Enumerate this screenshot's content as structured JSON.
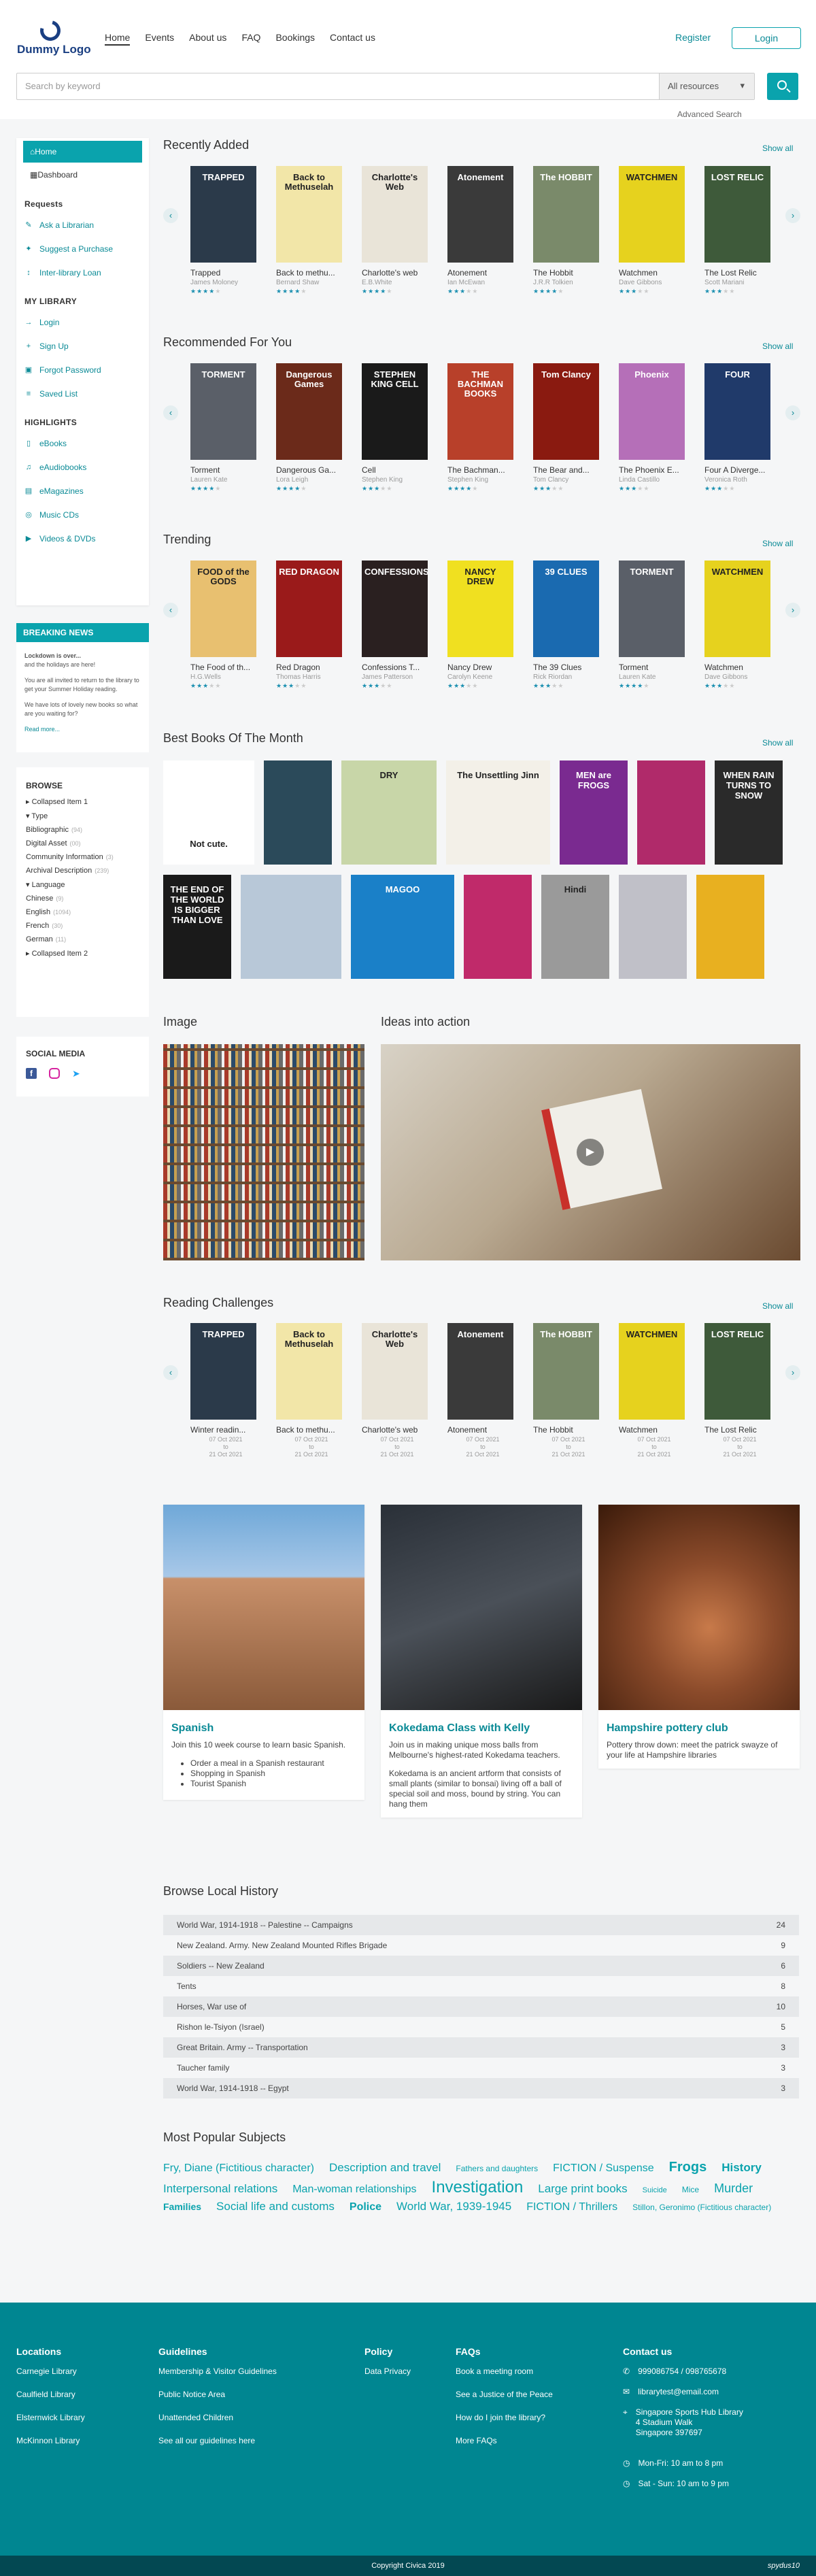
{
  "header": {
    "logo_text": "Dummy Logo",
    "nav": [
      "Home",
      "Events",
      "About us",
      "FAQ",
      "Bookings",
      "Contact us"
    ],
    "register": "Register",
    "login": "Login"
  },
  "search": {
    "placeholder": "Search by keyword",
    "scope": "All resources",
    "advanced": "Advanced Search"
  },
  "sidebar": {
    "home": "Home",
    "dashboard": "Dashboard",
    "requests_title": "Requests",
    "requests": [
      "Ask a Librarian",
      "Suggest a Purchase",
      "Inter-library Loan"
    ],
    "mylib_title": "MY LIBRARY",
    "mylib": [
      "Login",
      "Sign Up",
      "Forgot Password",
      "Saved List"
    ],
    "highlights_title": "HIGHLIGHTS",
    "highlights": [
      "eBooks",
      "eAudiobooks",
      "eMagazines",
      "Music CDs",
      "Videos & DVDs"
    ]
  },
  "news": {
    "title": "BREAKING NEWS",
    "line1": "Lockdown is over...",
    "line2": "and the holidays are here!",
    "line3": "You are all invited to return to the library to get your Summer Holiday reading.",
    "line4": "We have lots of lovely new books so what are you waiting for?",
    "more": "Read more..."
  },
  "browse": {
    "title": "BROWSE",
    "items": [
      {
        "label": "▸ Collapsed Item 1",
        "count": ""
      },
      {
        "label": "▾ Type",
        "count": ""
      },
      {
        "label": "Bibliographic",
        "count": "(94)"
      },
      {
        "label": "Digital Asset",
        "count": "(00)"
      },
      {
        "label": "Community Information",
        "count": "(3)"
      },
      {
        "label": "Archival Description",
        "count": "(239)"
      },
      {
        "label": "▾ Language",
        "count": ""
      },
      {
        "label": "Chinese",
        "count": "(9)"
      },
      {
        "label": "English",
        "count": "(1094)"
      },
      {
        "label": "French",
        "count": "(30)"
      },
      {
        "label": "German",
        "count": "(11)"
      },
      {
        "label": "▸ Collapsed Item 2",
        "count": ""
      }
    ]
  },
  "social": {
    "title": "SOCIAL MEDIA"
  },
  "sections": {
    "recent": "Recently Added",
    "recommended": "Recommended For You",
    "trending": "Trending",
    "best": "Best Books Of The Month",
    "image": "Image",
    "ideas": "Ideas into action",
    "challenges": "Reading Challenges",
    "history": "Browse Local History",
    "subjects": "Most Popular Subjects",
    "show_all": "Show all"
  },
  "recent": [
    {
      "title": "Trapped",
      "author": "James Moloney",
      "rating": 4,
      "cover": "TRAPPED",
      "color": "#2b3a4a"
    },
    {
      "title": "Back to methu...",
      "author": "Bernard Shaw",
      "rating": 4,
      "cover": "Back to Methuselah",
      "color": "#f2e6a8"
    },
    {
      "title": "Charlotte's web",
      "author": "E.B.White",
      "rating": 4,
      "cover": "Charlotte's Web",
      "color": "#e9e4d8"
    },
    {
      "title": "Atonement",
      "author": "Ian McEwan",
      "rating": 3,
      "cover": "Atonement",
      "color": "#3a3a3a"
    },
    {
      "title": "The Hobbit",
      "author": "J.R.R Tolkien",
      "rating": 4,
      "cover": "The HOBBIT",
      "color": "#7a8a6a"
    },
    {
      "title": "Watchmen",
      "author": "Dave Gibbons",
      "rating": 3,
      "cover": "WATCHMEN",
      "color": "#e6d21e"
    },
    {
      "title": "The Lost Relic",
      "author": "Scott Mariani",
      "rating": 3,
      "cover": "LOST RELIC",
      "color": "#3e5a3a"
    }
  ],
  "recommended": [
    {
      "title": "Torment",
      "author": "Lauren Kate",
      "rating": 4,
      "cover": "TORMENT",
      "color": "#5a5f68"
    },
    {
      "title": "Dangerous Ga...",
      "author": "Lora Leigh",
      "rating": 4,
      "cover": "Dangerous Games",
      "color": "#6b2a1a"
    },
    {
      "title": "Cell",
      "author": "Stephen King",
      "rating": 3,
      "cover": "STEPHEN KING CELL",
      "color": "#1a1a1a"
    },
    {
      "title": "The Bachman...",
      "author": "Stephen King",
      "rating": 4,
      "cover": "THE BACHMAN BOOKS",
      "color": "#b8402a"
    },
    {
      "title": "The Bear and...",
      "author": "Tom Clancy",
      "rating": 3,
      "cover": "Tom Clancy",
      "color": "#8a1a10"
    },
    {
      "title": "The Phoenix E...",
      "author": "Linda Castillo",
      "rating": 3,
      "cover": "Phoenix",
      "color": "#b56fb8"
    },
    {
      "title": "Four A Diverge...",
      "author": "Veronica Roth",
      "rating": 3,
      "cover": "FOUR",
      "color": "#203a6a"
    }
  ],
  "trending": [
    {
      "title": "The Food of th...",
      "author": "H.G.Wells",
      "rating": 3,
      "cover": "FOOD of the GODS",
      "color": "#e8c070"
    },
    {
      "title": "Red Dragon",
      "author": "Thomas Harris",
      "rating": 3,
      "cover": "RED DRAGON",
      "color": "#9a1a1a"
    },
    {
      "title": "Confessions T...",
      "author": "James Patterson",
      "rating": 3,
      "cover": "CONFESSIONS",
      "color": "#2a2020"
    },
    {
      "title": "Nancy Drew",
      "author": "Carolyn Keene",
      "rating": 3,
      "cover": "NANCY DREW",
      "color": "#f0e020"
    },
    {
      "title": "The 39 Clues",
      "author": "Rick Riordan",
      "rating": 3,
      "cover": "39 CLUES",
      "color": "#1a6ab0"
    },
    {
      "title": "Torment",
      "author": "Lauren Kate",
      "rating": 4,
      "cover": "TORMENT",
      "color": "#5a5f68"
    },
    {
      "title": "Watchmen",
      "author": "Dave Gibbons",
      "rating": 3,
      "cover": "WATCHMEN",
      "color": "#e6d21e"
    }
  ],
  "best_row1": [
    {
      "cover": "Not cute.",
      "color": "#fff"
    },
    {
      "cover": "",
      "color": "#2b4a5a"
    },
    {
      "cover": "DRY",
      "color": "#c8d6a8"
    },
    {
      "cover": "The Unsettling Jinn",
      "color": "#f3f0e8"
    },
    {
      "cover": "MEN are FROGS",
      "color": "#7a2a90"
    },
    {
      "cover": "",
      "color": "#b02a6a"
    },
    {
      "cover": "WHEN RAIN TURNS TO SNOW",
      "color": "#2a2a2a"
    }
  ],
  "best_row2": [
    {
      "cover": "THE END OF THE WORLD IS BIGGER THAN LOVE",
      "color": "#1a1a1a"
    },
    {
      "cover": "",
      "color": "#b8c8d8"
    },
    {
      "cover": "MAGOO",
      "color": "#1a80c8"
    },
    {
      "cover": "",
      "color": "#c02a6a"
    },
    {
      "cover": "Hindi",
      "color": "#9a9a9a"
    },
    {
      "cover": "",
      "color": "#c0c0c8"
    },
    {
      "cover": "",
      "color": "#e8b020"
    }
  ],
  "challenges": [
    {
      "title": "Winter readin...",
      "cover": "TRAPPED",
      "color": "#2b3a4a",
      "from": "07 Oct 2021",
      "to": "21 Oct 2021"
    },
    {
      "title": "Back to methu...",
      "cover": "Back to Methuselah",
      "color": "#f2e6a8",
      "from": "07 Oct 2021",
      "to": "21 Oct 2021"
    },
    {
      "title": "Charlotte's web",
      "cover": "Charlotte's Web",
      "color": "#e9e4d8",
      "from": "07 Oct 2021",
      "to": "21 Oct 2021"
    },
    {
      "title": "Atonement",
      "cover": "Atonement",
      "color": "#3a3a3a",
      "from": "07 Oct 2021",
      "to": "21 Oct 2021"
    },
    {
      "title": "The Hobbit",
      "cover": "The HOBBIT",
      "color": "#7a8a6a",
      "from": "07 Oct 2021",
      "to": "21 Oct 2021"
    },
    {
      "title": "Watchmen",
      "cover": "WATCHMEN",
      "color": "#e6d21e",
      "from": "07 Oct 2021",
      "to": "21 Oct 2021"
    },
    {
      "title": "The Lost Relic",
      "cover": "LOST RELIC",
      "color": "#3e5a3a",
      "from": "07 Oct 2021",
      "to": "21 Oct 2021"
    }
  ],
  "to_label": "to",
  "events": [
    {
      "title": "Spanish",
      "body": "Join this 10 week course to learn basic Spanish.",
      "bullets": [
        "Order a meal in a Spanish restaurant",
        "Shopping in Spanish",
        "Tourist Spanish"
      ],
      "color": "#c8906a"
    },
    {
      "title": "Kokedama Class with Kelly",
      "body": "Join us in making unique moss balls from Melbourne's highest-rated Kokedama teachers.",
      "body2": "Kokedama is an ancient artform that consists of small plants (similar to bonsai) living off a ball of special soil and moss, bound by string. You can hang them",
      "color": "#3a4048"
    },
    {
      "title": "Hampshire pottery club",
      "body": "Pottery throw down: meet the patrick swayze of your life at Hampshire libraries",
      "color": "#8a4a2a"
    }
  ],
  "history": [
    {
      "label": "World War, 1914-1918 -- Palestine -- Campaigns",
      "count": "24"
    },
    {
      "label": "New Zealand. Army. New Zealand Mounted Rifles Brigade",
      "count": "9"
    },
    {
      "label": "Soldiers -- New Zealand",
      "count": "6"
    },
    {
      "label": "Tents",
      "count": "8"
    },
    {
      "label": "Horses, War use of",
      "count": "10"
    },
    {
      "label": "Rishon le-Tsiyon (Israel)",
      "count": "5"
    },
    {
      "label": "Great Britain. Army -- Transportation",
      "count": "3"
    },
    {
      "label": "Taucher family",
      "count": "3"
    },
    {
      "label": "World War, 1914-1918 -- Egypt",
      "count": "3"
    }
  ],
  "subjects": [
    {
      "label": "Fry, Diane (Fictitious character)",
      "size": 16,
      "bold": false
    },
    {
      "label": "Description and travel",
      "size": 17,
      "bold": false
    },
    {
      "label": "Fathers and daughters",
      "size": 12,
      "bold": false
    },
    {
      "label": "FICTION / Suspense",
      "size": 16,
      "bold": false
    },
    {
      "label": "Frogs",
      "size": 20,
      "bold": true
    },
    {
      "label": "History",
      "size": 17,
      "bold": true
    },
    {
      "label": "Interpersonal relations",
      "size": 17,
      "bold": false
    },
    {
      "label": "Man-woman relationships",
      "size": 16,
      "bold": false
    },
    {
      "label": "Investigation",
      "size": 24,
      "bold": false
    },
    {
      "label": "Large print books",
      "size": 17,
      "bold": false
    },
    {
      "label": "Suicide",
      "size": 11,
      "bold": false
    },
    {
      "label": "Mice",
      "size": 12,
      "bold": false
    },
    {
      "label": "Murder",
      "size": 18,
      "bold": false
    },
    {
      "label": "Families",
      "size": 14,
      "bold": true
    },
    {
      "label": "Social life and customs",
      "size": 17,
      "bold": false
    },
    {
      "label": "Police",
      "size": 16,
      "bold": true
    },
    {
      "label": "World War, 1939-1945",
      "size": 17,
      "bold": false
    },
    {
      "label": "FICTION / Thrillers",
      "size": 16,
      "bold": false
    },
    {
      "label": "Stillon, Geronimo (Fictitious character)",
      "size": 12,
      "bold": false
    }
  ],
  "footer": {
    "locations_title": "Locations",
    "locations": [
      "Carnegie Library",
      "Caulfield Library",
      "Elsternwick Library",
      "McKinnon Library"
    ],
    "guidelines_title": "Guidelines",
    "guidelines": [
      "Membership & Visitor Guidelines",
      "Public Notice Area",
      "Unattended Children",
      "See all our guidelines here"
    ],
    "policy_title": "Policy",
    "policy": [
      "Data Privacy"
    ],
    "faqs_title": "FAQs",
    "faqs": [
      "Book a meeting room",
      "See a Justice of the Peace",
      "How do I join the library?",
      "More FAQs"
    ],
    "contact_title": "Contact us",
    "phone": "999086754 / 098765678",
    "email": "librarytest@email.com",
    "addr1": "Singapore Sports Hub Library",
    "addr2": "4 Stadium Walk",
    "addr3": "Singapore 397697",
    "hours1": "Mon-Fri: 10 am to 8 pm",
    "hours2": "Sat - Sun: 10 am to 9 pm",
    "copyright": "Copyright Civica 2019",
    "brand": "spydus10"
  }
}
